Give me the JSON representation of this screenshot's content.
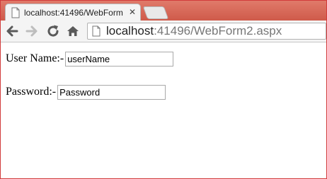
{
  "browser": {
    "tab": {
      "title": "localhost:41496/WebForm",
      "close_glyph": "✕",
      "page_icon": "page-icon"
    },
    "toolbar": {
      "back_icon": "back-arrow-icon",
      "forward_icon": "forward-arrow-icon",
      "reload_icon": "reload-icon",
      "home_icon": "home-icon"
    },
    "omnibox": {
      "host": "localhost",
      "path": ":41496/WebForm2.aspx"
    },
    "accent_color": "#d23b3b"
  },
  "form": {
    "username": {
      "label": "User Name:-",
      "placeholder": "userName"
    },
    "password": {
      "label": "Password:-",
      "placeholder": "Password"
    }
  }
}
